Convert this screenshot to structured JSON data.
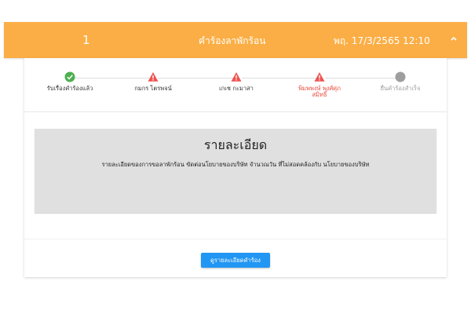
{
  "header": {
    "number": "1",
    "title": "คำร้องลาพักร้อน",
    "date": "พฤ. 17/3/2565 12:10",
    "collapse_icon": "chevron-up-icon"
  },
  "stepper": {
    "steps": [
      {
        "label": "รับเรื่องคำร้องแล้ว",
        "status": "done",
        "icon": "check-circle-icon"
      },
      {
        "label": "กมกร ไตรพจน์",
        "status": "error",
        "icon": "warning-icon"
      },
      {
        "label": "เกเช กะมาสา",
        "status": "error",
        "icon": "warning-icon"
      },
      {
        "label": "พิมพพงษ์ พงศ์ศุภสมิทธิ์",
        "status": "error",
        "icon": "warning-icon"
      },
      {
        "label": "ยื่นคำร้องสำเร็จ",
        "status": "pending",
        "icon": "circle-icon"
      }
    ]
  },
  "detail": {
    "title": "รายละเอียด",
    "text": "รายละเอียดของการขอลาพักร้อน ขัดต่อนโยบายของบริษัท จำนวณวัน ที่ไม่สอดคล้องกับ นโยบายของบริษัท"
  },
  "button": {
    "label": "ดูรายละเอียดคำร้อง"
  },
  "colors": {
    "header_bg": "#fbae45",
    "success": "#4caf50",
    "error": "#ef5350",
    "pending": "#9e9e9e",
    "primary": "#2196f3"
  }
}
